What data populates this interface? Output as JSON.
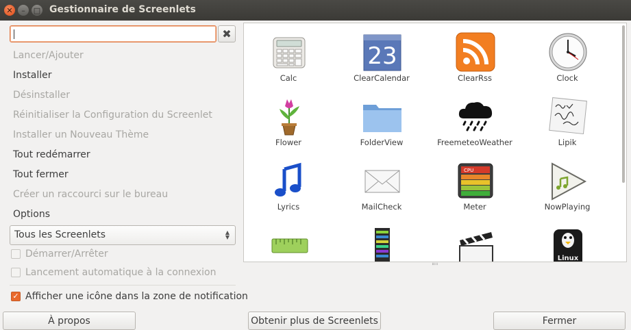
{
  "window": {
    "title": "Gestionnaire de Screenlets"
  },
  "search": {
    "value": "",
    "placeholder": ""
  },
  "actions": [
    {
      "label": "Lancer/Ajouter",
      "enabled": false
    },
    {
      "label": "Installer",
      "enabled": true
    },
    {
      "label": "Désinstaller",
      "enabled": false
    },
    {
      "label": "Réinitialiser la Configuration du Screenlet",
      "enabled": false
    },
    {
      "label": "Installer un Nouveau Thème",
      "enabled": false
    },
    {
      "label": "Tout redémarrer",
      "enabled": true
    },
    {
      "label": "Tout fermer",
      "enabled": true
    },
    {
      "label": "Créer un raccourci sur le bureau",
      "enabled": false
    },
    {
      "label": "Options",
      "enabled": true
    }
  ],
  "filter": {
    "selected": "Tous les Screenlets"
  },
  "options": {
    "start_stop": {
      "label": "Démarrer/Arrêter",
      "checked": false,
      "enabled": false
    },
    "autostart": {
      "label": "Lancement automatique à la connexion",
      "checked": false,
      "enabled": false
    },
    "tray_icon": {
      "label": "Afficher une icône dans la zone de notification",
      "checked": true,
      "enabled": true
    }
  },
  "screenlets": [
    {
      "name": "Calc",
      "icon": "calculator-icon"
    },
    {
      "name": "ClearCalendar",
      "icon": "calendar-icon",
      "calendar_day": "23"
    },
    {
      "name": "ClearRss",
      "icon": "rss-icon"
    },
    {
      "name": "Clock",
      "icon": "clock-icon"
    },
    {
      "name": "Flower",
      "icon": "flower-icon"
    },
    {
      "name": "FolderView",
      "icon": "folder-icon"
    },
    {
      "name": "FreemeteoWeather",
      "icon": "weather-rain-icon"
    },
    {
      "name": "Lipik",
      "icon": "sticky-note-icon"
    },
    {
      "name": "Lyrics",
      "icon": "music-note-icon"
    },
    {
      "name": "MailCheck",
      "icon": "mail-envelope-icon"
    },
    {
      "name": "Meter",
      "icon": "cpu-meter-icon",
      "meter_label": "CPU"
    },
    {
      "name": "NowPlaying",
      "icon": "play-icon"
    },
    {
      "name": "",
      "icon": "ruler-icon"
    },
    {
      "name": "",
      "icon": "equalizer-icon"
    },
    {
      "name": "",
      "icon": "clapperboard-icon"
    },
    {
      "name": "",
      "icon": "linux-tux-icon",
      "badge": "Linux"
    }
  ],
  "buttons": {
    "about": "À propos",
    "more": "Obtenir plus de Screenlets",
    "close": "Fermer"
  },
  "colors": {
    "accent": "#e9692c",
    "titlebar": "#3c3b37"
  }
}
